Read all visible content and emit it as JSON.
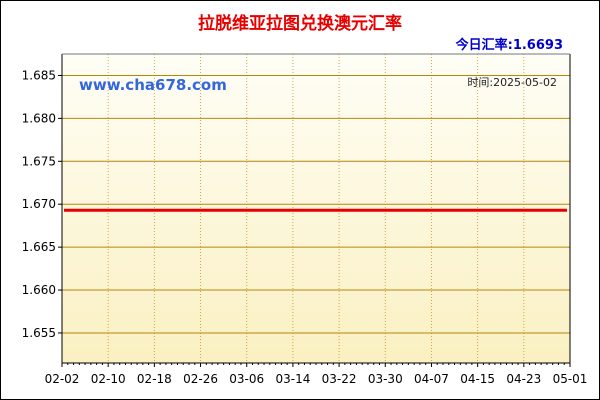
{
  "title": "拉脱维亚拉图兑换澳元汇率",
  "rate_label": "今日汇率:1.6693",
  "watermark": "www.cha678.com",
  "date_label": "时间:2025-05-02",
  "colors": {
    "title": "#e60000",
    "rate": "#0000cc",
    "line": "#e60000",
    "grid": "#b8860b",
    "watermark": "#3366dd"
  },
  "chart_data": {
    "type": "line",
    "title": "拉脱维亚拉图兑换澳元汇率",
    "xlabel": "",
    "ylabel": "",
    "x_ticks": [
      "02-02",
      "02-10",
      "02-18",
      "02-26",
      "03-06",
      "03-14",
      "03-22",
      "03-30",
      "04-07",
      "04-15",
      "04-23",
      "05-01"
    ],
    "y_ticks": [
      "1.655",
      "1.660",
      "1.665",
      "1.670",
      "1.675",
      "1.680",
      "1.685"
    ],
    "ylim": [
      1.6515,
      1.6875
    ],
    "grid": true,
    "series": [
      {
        "x": [
          "02-02",
          "05-02"
        ],
        "values": [
          1.6693,
          1.6693
        ]
      }
    ]
  }
}
